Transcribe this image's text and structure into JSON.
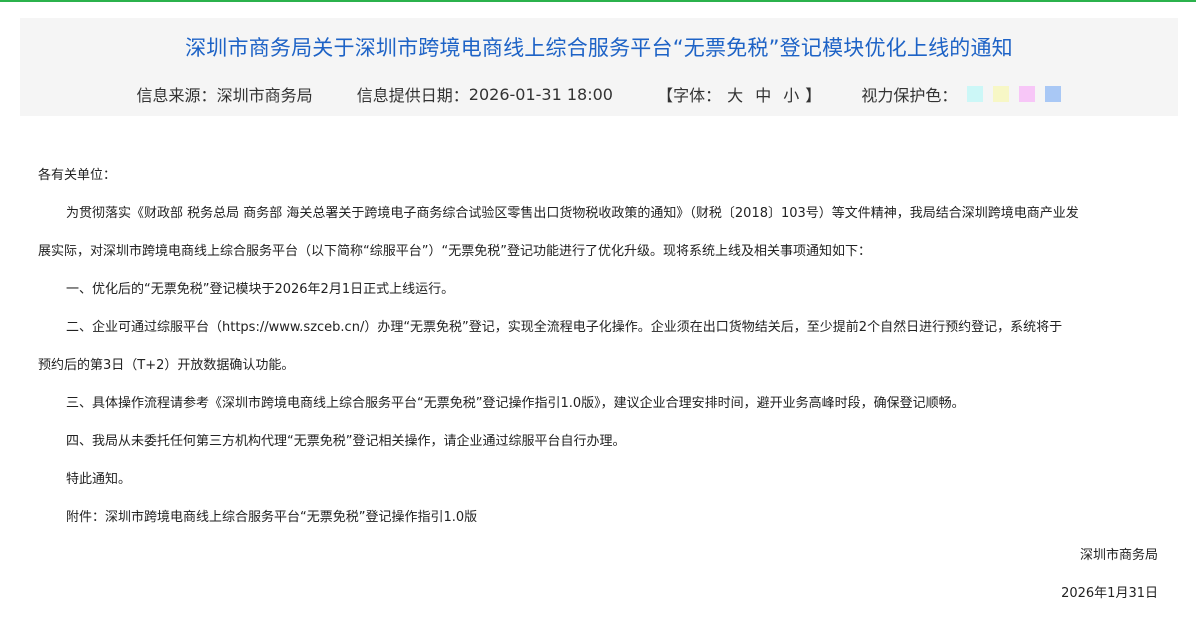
{
  "header": {
    "title": "深圳市商务局关于深圳市跨境电商线上综合服务平台“无票免税”登记模块优化上线的通知",
    "source_label": "信息来源：",
    "source_value": "深圳市商务局",
    "date_label": "信息提供日期：",
    "date_value": "2026-01-31 18:00",
    "font_open": "【字体：",
    "font_large": "大",
    "font_medium": "中",
    "font_small": "小",
    "font_close": "】",
    "eye_care_label": "视力保护色：",
    "swatch_colors": [
      "#ccf7f7",
      "#f7f7c6",
      "#f7c6f7",
      "#a9c8f5"
    ]
  },
  "body": {
    "salutation": "各有关单位：",
    "intro_line1": "为贯彻落实《财政部 税务总局 商务部 海关总署关于跨境电子商务综合试验区零售出口货物税收政策的通知》（财税〔2018〕103号）等文件精神，我局结合深圳跨境电商产业发",
    "intro_line2": "展实际，对深圳市跨境电商线上综合服务平台（以下简称“综服平台”）“无票免税”登记功能进行了优化升级。现将系统上线及相关事项通知如下：",
    "item1": "一、优化后的“无票免税”登记模块于2026年2月1日正式上线运行。",
    "item2_line1": "二、企业可通过综服平台（https://www.szceb.cn/）办理“无票免税”登记，实现全流程电子化操作。企业须在出口货物结关后，至少提前2个自然日进行预约登记，系统将于",
    "item2_line2": "预约后的第3日（T+2）开放数据确认功能。",
    "item3": "三、具体操作流程请参考《深圳市跨境电商线上综合服务平台“无票免税”登记操作指引1.0版》，建议企业合理安排时间，避开业务高峰时段，确保登记顺畅。",
    "item4": "四、我局从未委托任何第三方机构代理“无票免税”登记相关操作，请企业通过综服平台自行办理。",
    "closing": "特此通知。",
    "attachment": "附件：深圳市跨境电商线上综合服务平台“无票免税”登记操作指引1.0版",
    "signature": "深圳市商务局",
    "sign_date": "2026年1月31日"
  }
}
